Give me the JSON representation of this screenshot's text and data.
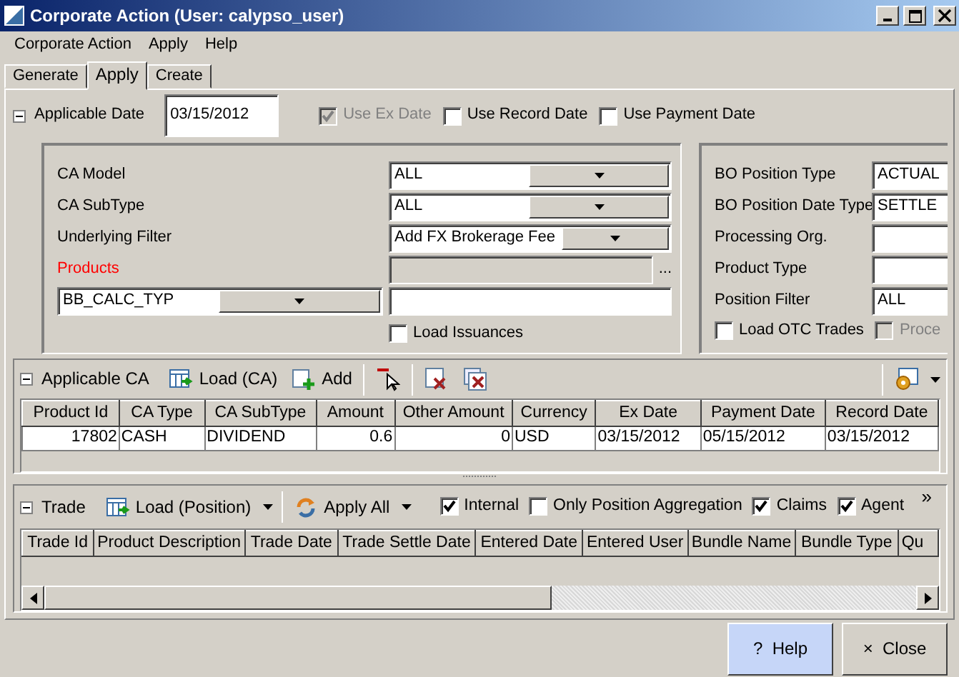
{
  "window": {
    "title": "Corporate Action (User: calypso_user)"
  },
  "menu": [
    "Corporate Action",
    "Apply",
    "Help"
  ],
  "tabs": [
    {
      "label": "Generate",
      "selected": false
    },
    {
      "label": "Apply",
      "selected": true
    },
    {
      "label": "Create",
      "selected": false
    }
  ],
  "date_filter": {
    "label": "Applicable Date",
    "value": "03/15/2012",
    "options": [
      {
        "label": "Use Ex Date",
        "checked": true,
        "disabled": true
      },
      {
        "label": "Use Record Date",
        "checked": false,
        "disabled": false
      },
      {
        "label": "Use Payment Date",
        "checked": false,
        "disabled": false
      }
    ]
  },
  "ca_filter": {
    "fields": [
      {
        "label": "CA Model",
        "kind": "select",
        "value": "ALL",
        "required": false
      },
      {
        "label": "CA SubType",
        "kind": "select",
        "value": "ALL",
        "required": false
      },
      {
        "label": "Underlying Filter",
        "kind": "select",
        "value": "Add FX Brokerage Fee",
        "required": false
      },
      {
        "label": "Products",
        "kind": "chooser",
        "chooser_button": "...",
        "required": true
      }
    ],
    "attribute": {
      "value": "BB_CALC_TYP"
    },
    "load_issuances": {
      "label": "Load Issuances",
      "checked": false,
      "disabled": false
    }
  },
  "position_filter": {
    "fields": [
      {
        "label": "BO Position Type",
        "value": "ACTUAL"
      },
      {
        "label": "BO Position Date Type",
        "value": "SETTLE"
      },
      {
        "label": "Processing Org."
      },
      {
        "label": "Product Type"
      },
      {
        "label": "Position Filter",
        "value": "ALL"
      }
    ],
    "options": [
      {
        "label": "Load OTC Trades",
        "checked": false,
        "disabled": false
      },
      {
        "label": "Proce",
        "checked": false,
        "disabled": true
      }
    ]
  },
  "applicable_ca": {
    "title": "Applicable CA",
    "tools": [
      {
        "kind": "load",
        "label": "Load (CA)"
      },
      {
        "kind": "add",
        "label": "Add"
      },
      {
        "kind": "sep"
      },
      {
        "kind": "remove"
      },
      {
        "kind": "sep"
      },
      {
        "kind": "delete"
      },
      {
        "kind": "delete_all"
      }
    ],
    "columns": [
      {
        "label": "Product Id",
        "numeric": true
      },
      {
        "label": "CA Type",
        "numeric": false
      },
      {
        "label": "CA SubType",
        "numeric": false
      },
      {
        "label": "Amount",
        "numeric": true
      },
      {
        "label": "Other Amount",
        "numeric": true
      },
      {
        "label": "Currency",
        "numeric": false
      },
      {
        "label": "Ex Date",
        "numeric": false
      },
      {
        "label": "Payment Date",
        "numeric": false
      },
      {
        "label": "Record Date",
        "numeric": false
      }
    ],
    "rows": [
      [
        "17802",
        "CASH",
        "DIVIDEND",
        "0.6",
        "0",
        "USD",
        "03/15/2012",
        "05/15/2012",
        "03/15/2012"
      ]
    ]
  },
  "trade": {
    "title": "Trade",
    "tools": [
      {
        "kind": "load",
        "label": "Load (Position)",
        "dropdown": true
      },
      {
        "kind": "sep"
      },
      {
        "kind": "apply",
        "label": "Apply All",
        "dropdown": true
      }
    ],
    "options": [
      {
        "label": "Internal",
        "checked": true
      },
      {
        "label": "Only Position Aggregation",
        "checked": false
      },
      {
        "label": "Claims",
        "checked": true
      },
      {
        "label": "Agent",
        "checked": true
      }
    ],
    "overflow": "»",
    "columns": [
      "Trade Id",
      "Product Description",
      "Trade Date",
      "Trade Settle Date",
      "Entered Date",
      "Entered User",
      "Bundle Name",
      "Bundle Type",
      "Qu"
    ]
  },
  "buttons": [
    {
      "icon": "?",
      "label": "Help",
      "highlighted": true
    },
    {
      "icon": "×",
      "label": "Close",
      "highlighted": false
    }
  ]
}
